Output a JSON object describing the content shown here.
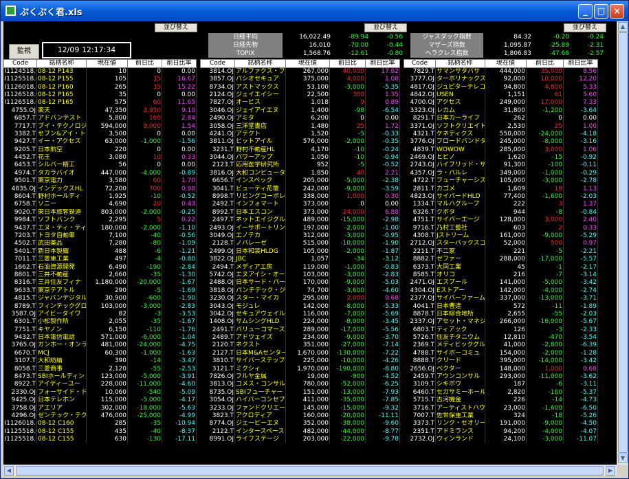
{
  "window": {
    "title": "ぷくぷく君.xls"
  },
  "controls": {
    "sort_label": "並び替え",
    "monitor_label": "監視",
    "clock": "12/09 12:17:34"
  },
  "headers": [
    "Code",
    "銘柄名称",
    "現在値",
    "前日比",
    "前日比率"
  ],
  "indices_left": [
    {
      "name": "日経平均",
      "price": "16,022.49",
      "chg": "-89.94",
      "pct": "-0.56"
    },
    {
      "name": "日経先物",
      "price": "16,010",
      "chg": "-70.00",
      "pct": "-0.44"
    },
    {
      "name": "TOPIX",
      "price": "1,568.76",
      "chg": "-12.61",
      "pct": "-0.80"
    }
  ],
  "indices_right": [
    {
      "name": "ジャスダック指数",
      "price": "84.32",
      "chg": "-0.20",
      "pct": "-0.24"
    },
    {
      "name": "マザーズ指数",
      "price": "1,095.87",
      "chg": "-25.89",
      "pct": "-2.31"
    },
    {
      "name": "ヘラクレス指数",
      "price": "1,806.83",
      "chg": "-47.66",
      "pct": "-2.57"
    }
  ],
  "table1": [
    [
      "I1124518.OJ",
      "08-12 P143",
      "10",
      "0",
      "0.00"
    ],
    [
      "I1125518.OJ",
      "08-12 P155",
      "105",
      "35",
      "16.67"
    ],
    [
      "I1126018.OJ",
      "08-12 P160",
      "265",
      "35",
      "15.22"
    ],
    [
      "I1126518.OJ",
      "08-12 P165",
      "35",
      "0",
      "0.00"
    ],
    [
      "I1126518.OJ",
      "08-12 P165",
      "575",
      "60",
      "11.65"
    ],
    [
      "4755.OJ",
      "楽天",
      "47,350",
      "3,950",
      "9.10"
    ],
    [
      "6857.T",
      "アドバンテスト",
      "5,800",
      "160",
      "2.84"
    ],
    [
      "7717.T",
      "ブイ・テクノロジ",
      "594,000",
      "9,000",
      "1.54"
    ],
    [
      "3382.T",
      "セブン&アイ・ト",
      "3,500",
      "0",
      "0.00"
    ],
    [
      "9427.T",
      "イー・アクセス",
      "63,000",
      "-1,000",
      "-1.56"
    ],
    [
      "9205.T",
      "日本航空",
      "220",
      "0",
      "0.00"
    ],
    [
      "4452.T",
      "花王",
      "3,080",
      "10",
      "0.33"
    ],
    [
      "6453.T",
      "シルバー精工",
      "56",
      "0",
      "0.00"
    ],
    [
      "4974.T",
      "タカラバイオ",
      "447,000",
      "-4,000",
      "-0.89"
    ],
    [
      "9501.T",
      "東京電力",
      "3,580",
      "60",
      "1.70"
    ],
    [
      "4835.OJ",
      "インデックスHL",
      "72,200",
      "700",
      "0.98"
    ],
    [
      "8604.T",
      "野村ホールディ",
      "1,925",
      "-10",
      "-0.52"
    ],
    [
      "6758.T",
      "ソニー",
      "4,690",
      "20",
      "0.43"
    ],
    [
      "9020.T",
      "東日本旅客鉄道",
      "803,000",
      "-2,000",
      "-0.25"
    ],
    [
      "9984.T",
      "ソフトバンク",
      "2,295",
      "5",
      "0.22"
    ],
    [
      "9437.T",
      "エヌ・ティ・ティ",
      "180,000",
      "-2,000",
      "-1.10"
    ],
    [
      "7203.T",
      "トヨタ自動車",
      "7,100",
      "-40",
      "-0.56"
    ],
    [
      "4502.T",
      "武田薬品",
      "7,280",
      "-80",
      "-1.09"
    ],
    [
      "5401.T",
      "新日本製鐵",
      "488",
      "-6",
      "-1.21"
    ],
    [
      "7011.T",
      "三菱重工業",
      "497",
      "-4",
      "-0.80"
    ],
    [
      "1662.T",
      "石油資源開発",
      "6,490",
      "-190",
      "-2.84"
    ],
    [
      "8801.T",
      "三井不動産",
      "2,660",
      "-35",
      "-1.30"
    ],
    [
      "8316.T",
      "三井住友フィナ",
      "1,180,000",
      "-20,000",
      "-1.67"
    ],
    [
      "9633.T",
      "東京テアトル",
      "290",
      "-5",
      "-1.69"
    ],
    [
      "4815.T",
      "ジャパンデジタル",
      "30,900",
      "-600",
      "-1.90"
    ],
    [
      "8789.T",
      "フィンテックグロ",
      "103,000",
      "-3,000",
      "-2.83"
    ],
    [
      "3587.OJ",
      "アイビーダイワ",
      "82",
      "-3",
      "-3.53"
    ],
    [
      "6301.T",
      "小松製作所",
      "2,055",
      "-35",
      "-1.67"
    ],
    [
      "7751.T",
      "キヤノン",
      "6,150",
      "-110",
      "-1.76"
    ],
    [
      "9432.T",
      "日本電信電話",
      "571,000",
      "-6,000",
      "-1.04"
    ],
    [
      "3765.OJ",
      "ガンホー・オンラ",
      "481,000",
      "-24,000",
      "-4.75"
    ],
    [
      "6670.T",
      "MCJ",
      "60,300",
      "-1,000",
      "-1.63"
    ],
    [
      "3107.T",
      "大和紡績",
      "390",
      "-14",
      "-3.47"
    ],
    [
      "8058.T",
      "三菱商事",
      "2,120",
      "-55",
      "-2.53"
    ],
    [
      "8473.T",
      "SBIホールディン",
      "123,000",
      "-5,000",
      "-3.91"
    ],
    [
      "8922.T",
      "アイディーユー",
      "228,000",
      "-11,000",
      "-4.60"
    ],
    [
      "2330.OJ",
      "フォーサイド・ド",
      "10,060",
      "-540",
      "-5.09"
    ],
    [
      "9425.OJ",
      "日本テレホン",
      "115,000",
      "-5,000",
      "-4.17"
    ],
    [
      "3758.OJ",
      "アエリア",
      "302,000",
      "-18,000",
      "-5.63"
    ],
    [
      "4296.OJ",
      "ゼンテック・テク",
      "476,000",
      "-25,000",
      "-4.99"
    ],
    [
      "I1126018.OJ",
      "08-12 C160",
      "285",
      "-35",
      "-10.94"
    ],
    [
      "I1125518.OJ",
      "08-12 C155",
      "435",
      "-40",
      "-8.37"
    ],
    [
      "I1125518.OJ",
      "08-12 C155",
      "630",
      "-130",
      "-17.11"
    ]
  ],
  "table2": [
    [
      "3814.OJ",
      "アルファクス・フ",
      "267,000",
      "40,000",
      "17.62"
    ],
    [
      "3857.OJ",
      "パシオセキュア",
      "375,000",
      "4,000",
      "1.08"
    ],
    [
      "8734.OJ",
      "アストマックス",
      "53,100",
      "-3,000",
      "-5.35"
    ],
    [
      "2124.OJ",
      "ジェイエイシー",
      "22,500",
      "300",
      "1.35"
    ],
    [
      "7827.OJ",
      "オービス",
      "1,018",
      "9",
      "0.89"
    ],
    [
      "3046.OJ",
      "ジェイアイエヌ",
      "1,400",
      "-98",
      "-6.54"
    ],
    [
      "2490.OJ",
      "アミタ",
      "6,200",
      "0",
      "0.00"
    ],
    [
      "3058.OJ",
      "三洋堂書店",
      "1,480",
      "25",
      "1.72"
    ],
    [
      "4241.OJ",
      "アテクト",
      "1,520",
      "-5",
      "-0.33"
    ],
    [
      "3811.OJ",
      "ビットアイル",
      "576,000",
      "-2,000",
      "-0.35"
    ],
    [
      "3231.T",
      "野村不動産HL",
      "4,170",
      "-10",
      "-0.24"
    ],
    [
      "3044.OJ",
      "パワーアップ",
      "1,050",
      "-10",
      "-0.94"
    ],
    [
      "2123.T",
      "応用医学研究所",
      "952",
      "-5",
      "-0.52"
    ],
    [
      "3816.OJ",
      "大和コンピュータ",
      "1,850",
      "40",
      "2.21"
    ],
    [
      "6656.T",
      "インスペック",
      "205,000",
      "-5,000",
      "-2.38"
    ],
    [
      "3041.T",
      "ビューティ花壇",
      "242,000",
      "-9,000",
      "-3.59"
    ],
    [
      "8998.T",
      "リビングコーポレ",
      "338,000",
      "1,000",
      "0.30"
    ],
    [
      "2492.T",
      "インフォマート",
      "373,000",
      "0",
      "0.00"
    ],
    [
      "8992.T",
      "日本エスコン",
      "373,000",
      "24,000",
      "6.88"
    ],
    [
      "2497.T",
      "ネットエイジグル",
      "489,000",
      "-15,000",
      "-2.98"
    ],
    [
      "2493.OJ",
      "イーサポートリン",
      "197,000",
      "-2,000",
      "-1.00"
    ],
    [
      "3049.OJ",
      "エノテカ",
      "312,000",
      "-3,000",
      "-0.95"
    ],
    [
      "2128.T",
      "ノバレーゼ",
      "515,000",
      "-10,000",
      "-1.90"
    ],
    [
      "2499.OJ",
      "日本和装HLDG",
      "105,000",
      "-2,000",
      "-1.87"
    ],
    [
      "3822.OJ",
      "JBC",
      "1,057",
      "-34",
      "-3.12"
    ],
    [
      "2494.T",
      "メディアエ房",
      "119,000",
      "-1,000",
      "-0.83"
    ],
    [
      "5742.OJ",
      "エヌアイシ・オー",
      "103,000",
      "-3,000",
      "-2.83"
    ],
    [
      "2488.OJ",
      "日本サード・パー",
      "170,000",
      "-9,000",
      "-5.03"
    ],
    [
      "3818.OJ",
      "パンチテック・ジ",
      "74,700",
      "-3,600",
      "-4.60"
    ],
    [
      "3230.OJ",
      "スター・マイカ",
      "295,000",
      "2,000",
      "0.68"
    ],
    [
      "3043.OJ",
      "モジュレ",
      "142,000",
      "-8,000",
      "-5.33"
    ],
    [
      "3042.OJ",
      "セキュアヴェイル",
      "116,000",
      "-7,000",
      "-5.69"
    ],
    [
      "1408.OJ",
      "サムシングHLD",
      "224,000",
      "-8,000",
      "-3.45"
    ],
    [
      "2491.T",
      "バリューコマース",
      "289,000",
      "-17,000",
      "-5.56"
    ],
    [
      "2489.T",
      "アドウェイズ",
      "234,000",
      "-9,000",
      "-3.70"
    ],
    [
      "2120.T",
      "ネクスト",
      "351,000",
      "-27,000",
      "-7.14"
    ],
    [
      "2127.T",
      "日本M&Aセンター",
      "1,670,000",
      "-130,000",
      "-7.22"
    ],
    [
      "3810.T",
      "サイバーステップ",
      "225,000",
      "-10,000",
      "-4.26"
    ],
    [
      "3121.T",
      "ミクシィ",
      "1,970,000",
      "-190,000",
      "-8.80"
    ],
    [
      "7826.OJ",
      "フルヤ金属",
      "19,000",
      "-900",
      "-4.52"
    ],
    [
      "3813.OJ",
      "ゴメス・コンサル",
      "780,000",
      "-52,000",
      "-6.25"
    ],
    [
      "8735.OJ",
      "SBIフューチャー",
      "151,000",
      "-13,000",
      "-7.93"
    ],
    [
      "3054.OJ",
      "ハイパーコンセプ",
      "411,000",
      "-35,000",
      "-7.85"
    ],
    [
      "3233.OJ",
      "ファンドクリエー",
      "145,000",
      "-15,000",
      "-9.32"
    ],
    [
      "3823.T",
      "アクロディア",
      "160,000",
      "-20,000",
      "-11.11"
    ],
    [
      "8774.OJ",
      "ジェーピーエヌ",
      "352,000",
      "-38,000",
      "-9.60"
    ],
    [
      "2122.T",
      "インタースペース",
      "482,000",
      "-44,000",
      "-8.77"
    ],
    [
      "8991.OJ",
      "ライフステージ",
      "203,000",
      "-22,000",
      "-9.78"
    ]
  ],
  "table3": [
    [
      "7829.T",
      "サマンサタバサ",
      "444,000",
      "35,000",
      "8.56"
    ],
    [
      "3777.OJ",
      "ターボリナックス",
      "92,000",
      "10,000",
      "12.20"
    ],
    [
      "4817.OJ",
      "ジュピターテレコ",
      "94,800",
      "4,800",
      "5.33"
    ],
    [
      "4842.OJ",
      "USEN",
      "1,151",
      "61",
      "5.60"
    ],
    [
      "4700.OJ",
      "アクセス",
      "249,000",
      "17,000",
      "7.33"
    ],
    [
      "3323.OJ",
      "レカム",
      "31,800",
      "-1,200",
      "-3.64"
    ],
    [
      "8291.T",
      "日本カーライフ",
      "262",
      "0",
      "0.00"
    ],
    [
      "3371.OJ",
      "ソフトクリエイト",
      "2,530",
      "25",
      "1.00"
    ],
    [
      "4321.T",
      "ケネディクス",
      "550,000",
      "-24,000",
      "-4.18"
    ],
    [
      "3776.OJ",
      "ブロードバンドタ",
      "245,000",
      "-8,000",
      "-3.16"
    ],
    [
      "4839.T",
      "WOWOW",
      "285,000",
      "3,000",
      "1.06"
    ],
    [
      "2469.OJ",
      "ヒビノ",
      "1,620",
      "-15",
      "-0.92"
    ],
    [
      "2743.OJ",
      "ハイブリッド・サ",
      "91,300",
      "-100",
      "-0.11"
    ],
    [
      "4357.OJ",
      "ラ・パルレ",
      "349,000",
      "-1,000",
      "-0.29"
    ],
    [
      "4722.T",
      "フューチャーシス",
      "105,000",
      "-3,000",
      "-2.78"
    ],
    [
      "2811.T",
      "カゴメ",
      "1,609",
      "18",
      "1.13"
    ],
    [
      "4823.OJ",
      "サイバードHLD",
      "77,400",
      "-1,600",
      "-2.03"
    ],
    [
      "1334.T",
      "マルハグループ",
      "222",
      "3",
      "1.37"
    ],
    [
      "6326.T",
      "クボタ",
      "944",
      "-8",
      "-0.84"
    ],
    [
      "4751.T",
      "サイバーエージ",
      "128,000",
      "3,000",
      "2.40"
    ],
    [
      "9716.T",
      "乃村工藝社",
      "603",
      "2",
      "0.33"
    ],
    [
      "4308.T",
      "Jストリーム",
      "161,000",
      "-9,000",
      "-5.29"
    ],
    [
      "2712.OJ",
      "スターバックスコ",
      "52,000",
      "500",
      "0.97"
    ],
    [
      "2211.T",
      "不二家",
      "221",
      "-5",
      "-2.21"
    ],
    [
      "8882.T",
      "ゼファー",
      "288,000",
      "-17,000",
      "-5.57"
    ],
    [
      "6373.T",
      "大同工業",
      "45",
      "-1",
      "-2.17"
    ],
    [
      "8585.T",
      "オリコ",
      "216",
      "-7",
      "-3.14"
    ],
    [
      "2471.OJ",
      "エスプール",
      "141,000",
      "-5,000",
      "-3.42"
    ],
    [
      "4304.OJ",
      "Eストアー",
      "142,000",
      "-4,000",
      "-2.74"
    ],
    [
      "2377.OJ",
      "サイバーファーム",
      "337,000",
      "-13,000",
      "-3.71"
    ],
    [
      "4041.T",
      "日本曹達",
      "572",
      "-11",
      "-1.89"
    ],
    [
      "8878.T",
      "日本綜合地所",
      "2,655",
      "-55",
      "-2.03"
    ],
    [
      "2337.OJ",
      "アセット・マネジ",
      "266,000",
      "-16,000",
      "-5.67"
    ],
    [
      "6803.T",
      "ティアック",
      "126",
      "-3",
      "-2.33"
    ],
    [
      "5726.T",
      "住友チタニウム",
      "12,810",
      "-470",
      "-3.54"
    ],
    [
      "2369.T",
      "メディビックグル",
      "41,000",
      "-2,800",
      "-6.39"
    ],
    [
      "4788.T",
      "サイボーコミュ",
      "154,000",
      "-2,000",
      "-1.28"
    ],
    [
      "8888.T",
      "クリード",
      "395,000",
      "-14,000",
      "-3.42"
    ],
    [
      "2656.OJ",
      "ベクター",
      "148,000",
      "1,000",
      "0.68"
    ],
    [
      "2459.T",
      "アウンコンサル",
      "293,000",
      "-11,000",
      "-3.62"
    ],
    [
      "3109.T",
      "シキボウ",
      "187",
      "-6",
      "-3.11"
    ],
    [
      "6460.T",
      "セガサミーホール",
      "2,820",
      "-160",
      "-5.37"
    ],
    [
      "5715.T",
      "古河機金",
      "226",
      "-14",
      "-4.73"
    ],
    [
      "3716.T",
      "アーティストハウ",
      "23,000",
      "-1,600",
      "-6.50"
    ],
    [
      "7007.T",
      "佐世保重工業",
      "324",
      "-18",
      "-5.26"
    ],
    [
      "3373.T",
      "リンク・セオリー",
      "191,000",
      "-9,000",
      "-4.50"
    ],
    [
      "2351.T",
      "アドミランス",
      "94,200",
      "-4,000",
      "-4.07"
    ],
    [
      "2732.OJ",
      "ウィンランド",
      "24,100",
      "-3,000",
      "-11.07"
    ]
  ]
}
